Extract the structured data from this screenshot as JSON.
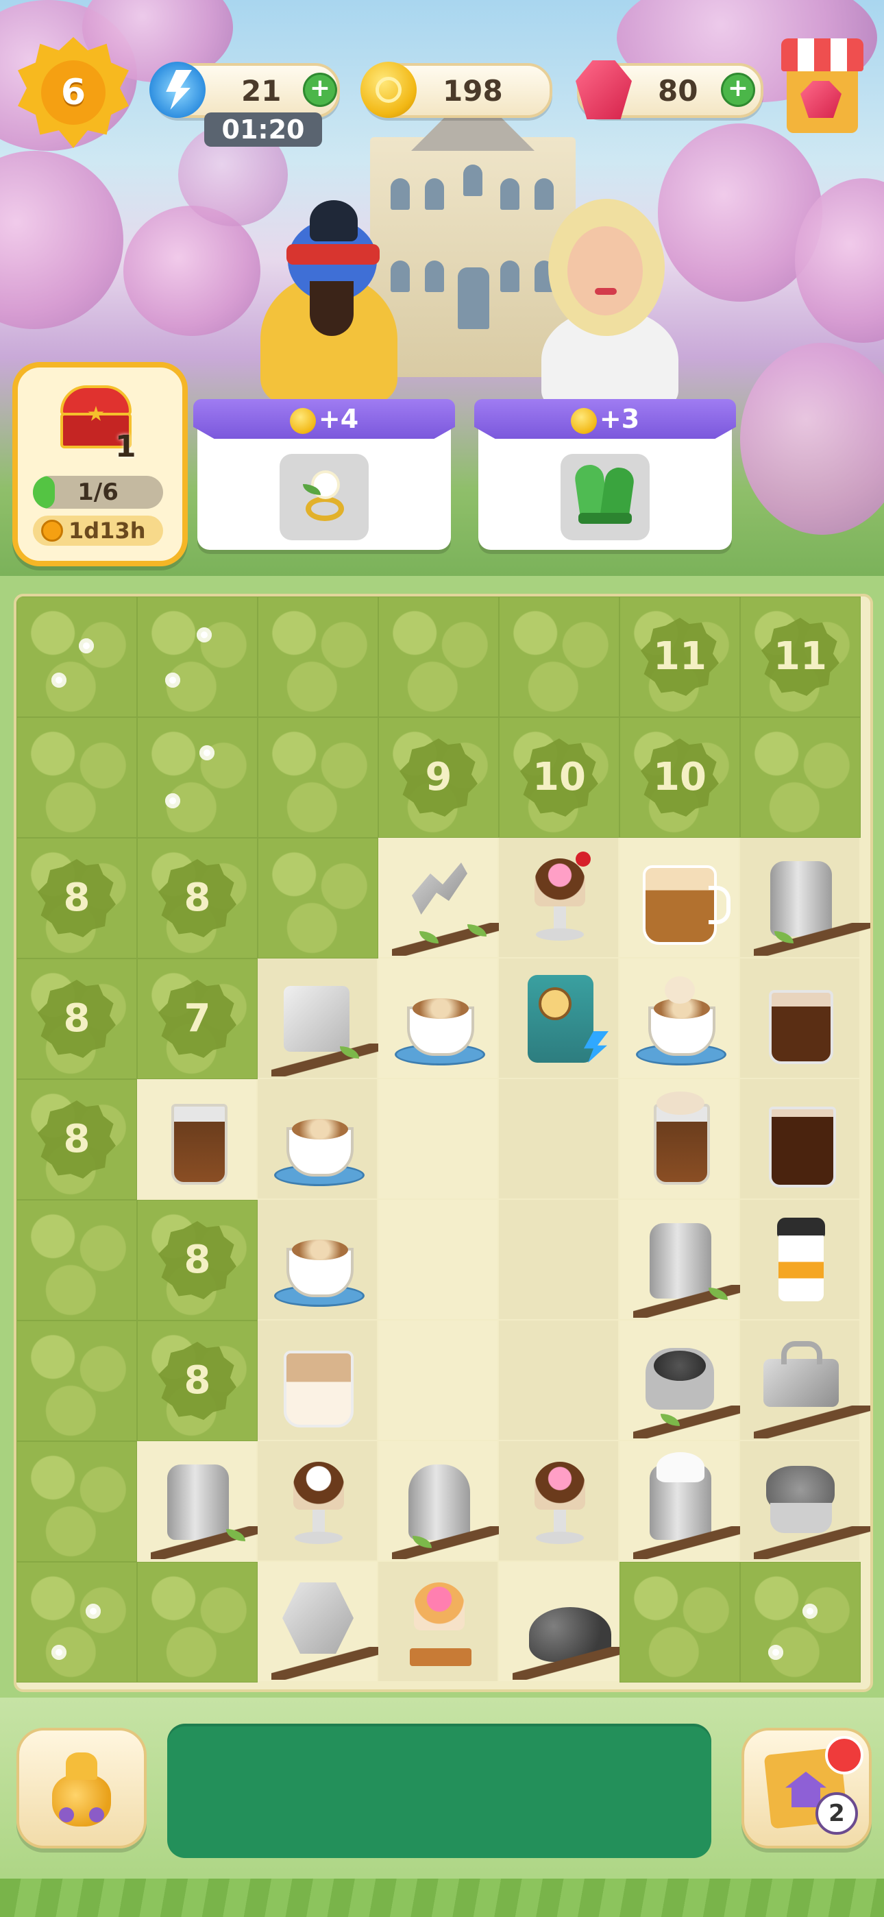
{
  "hud": {
    "level": "6",
    "energy": "21",
    "energy_timer": "01:20",
    "coins": "198",
    "gems": "80"
  },
  "chest": {
    "count": "1",
    "progress_text": "1/6",
    "progress_fraction": 0.1667,
    "timer": "1d13h"
  },
  "orders": [
    {
      "reward": "+4",
      "item_icon": "flower-ring-icon"
    },
    {
      "reward": "+3",
      "item_icon": "gardening-gloves-icon"
    }
  ],
  "board": {
    "locked_cells": [
      {
        "row": 0,
        "col": 5,
        "level": "11"
      },
      {
        "row": 0,
        "col": 6,
        "level": "11"
      },
      {
        "row": 1,
        "col": 3,
        "level": "9"
      },
      {
        "row": 1,
        "col": 4,
        "level": "10"
      },
      {
        "row": 1,
        "col": 5,
        "level": "10"
      },
      {
        "row": 2,
        "col": 0,
        "level": "8"
      },
      {
        "row": 2,
        "col": 1,
        "level": "8"
      },
      {
        "row": 3,
        "col": 0,
        "level": "8"
      },
      {
        "row": 3,
        "col": 1,
        "level": "7"
      },
      {
        "row": 4,
        "col": 0,
        "level": "8"
      },
      {
        "row": 5,
        "col": 1,
        "level": "8"
      },
      {
        "row": 6,
        "col": 1,
        "level": "8"
      }
    ]
  },
  "home": {
    "badge_count": "2"
  },
  "colors": {
    "accent_purple": "#8a66e6",
    "coin_gold": "#f2b815",
    "gem_red": "#e83a5c",
    "energy_blue": "#2fa8ff",
    "storage_green": "#23905a"
  }
}
